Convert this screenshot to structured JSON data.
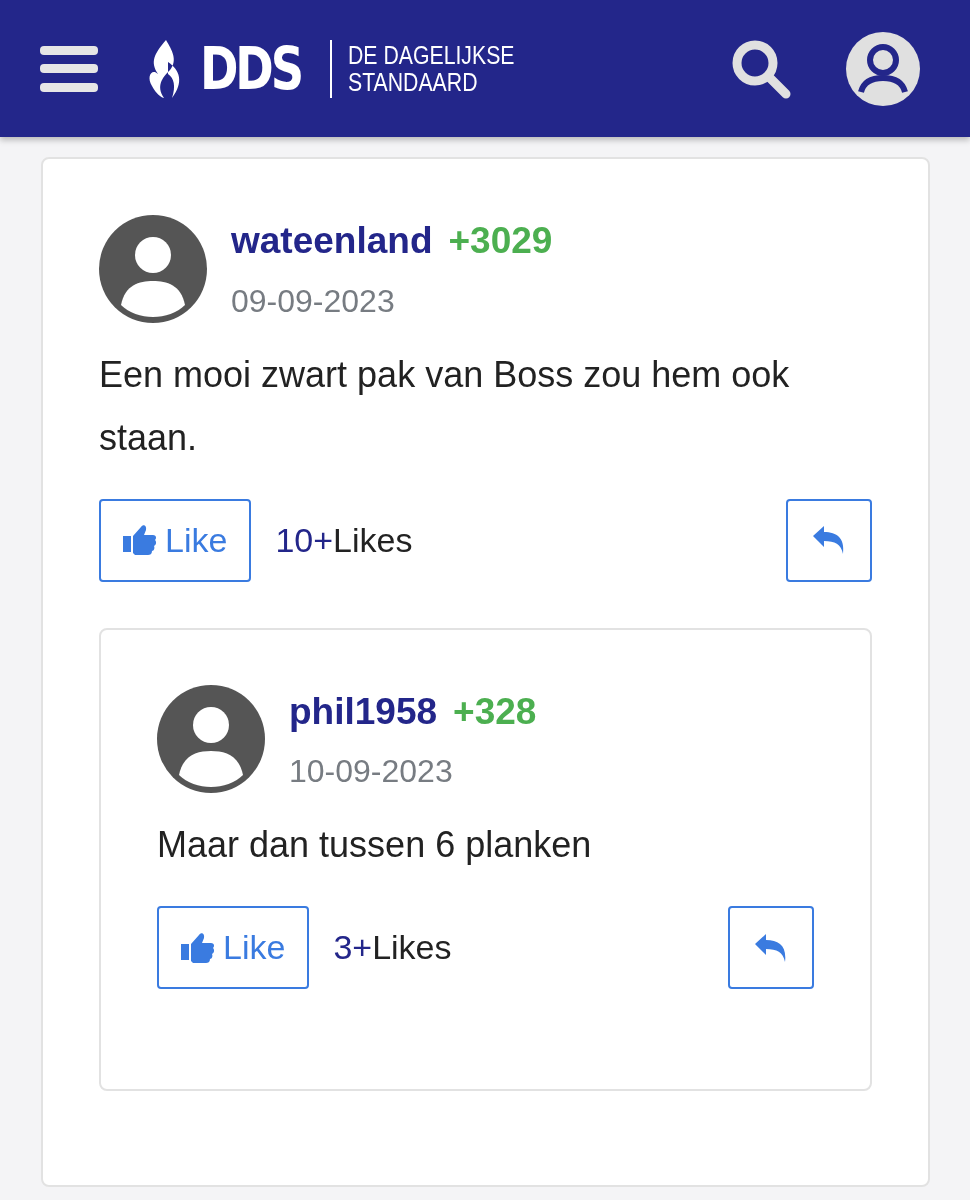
{
  "header": {
    "brand_short": "DDS",
    "brand_line_1": "DE DAGELIJKSE",
    "brand_line_2": "STANDAARD"
  },
  "comments": [
    {
      "username": "wateenland",
      "score": "+3029",
      "date": "09-09-2023",
      "text": "Een mooi zwart pak van Boss zou hem ook staan.",
      "like_label": "Like",
      "likes_count": "10+",
      "likes_label": "Likes",
      "replies": [
        {
          "username": "phil1958",
          "score": "+328",
          "date": "10-09-2023",
          "text": "Maar dan tussen 6 planken",
          "like_label": "Like",
          "likes_count": "3+",
          "likes_label": "Likes"
        }
      ]
    }
  ]
}
